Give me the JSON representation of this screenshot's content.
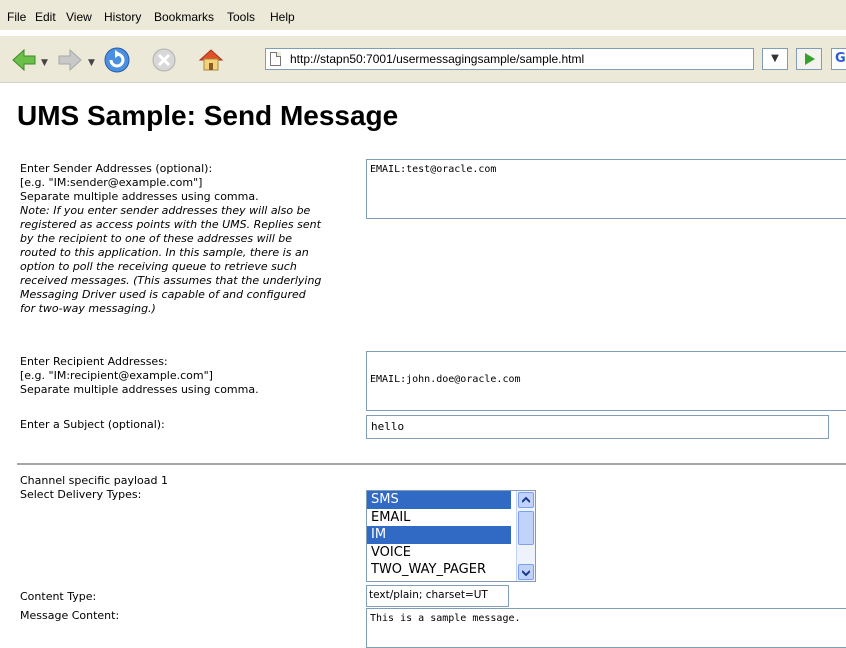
{
  "menu": {
    "items": [
      {
        "label": "File"
      },
      {
        "label": "Edit"
      },
      {
        "label": "View"
      },
      {
        "label": "History"
      },
      {
        "label": "Bookmarks"
      },
      {
        "label": "Tools"
      },
      {
        "label": "Help"
      }
    ]
  },
  "toolbar": {
    "url": "http://stapn50:7001/usermessagingsample/sample.html",
    "icons": [
      "back-arrow-icon",
      "forward-arrow-icon",
      "reload-icon",
      "stop-icon",
      "home-icon",
      "page-icon",
      "go-icon",
      "search-icon"
    ]
  },
  "page": {
    "title": "UMS Sample: Send Message"
  },
  "sender": {
    "label_line1": "Enter Sender Addresses (optional):",
    "label_line2": "[e.g. \"IM:sender@example.com\"]",
    "label_line3": "Separate multiple addresses using comma.",
    "note_lines": [
      "Note: If you enter sender addresses they will also be",
      "registered as access points with the UMS. Replies sent",
      "by the recipient to one of these addresses will be",
      "routed to this application. In this sample, there is an",
      "option to poll the receiving queue to retrieve such",
      "received messages. (This assumes that the underlying",
      "Messaging Driver used is capable of and configured",
      "for two-way messaging.)"
    ],
    "value": "EMAIL:test@oracle.com"
  },
  "recipient": {
    "label_line1": "Enter Recipient Addresses:",
    "label_line2": "[e.g. \"IM:recipient@example.com\"]",
    "label_line3": "Separate multiple addresses using comma.",
    "value": "EMAIL:john.doe@oracle.com"
  },
  "subject": {
    "label": "Enter a Subject (optional):",
    "value": "hello"
  },
  "payload": {
    "heading": "Channel specific payload 1",
    "delivery_label": "Select Delivery Types:",
    "delivery_options": [
      {
        "label": "SMS",
        "selected": true
      },
      {
        "label": "EMAIL",
        "selected": false
      },
      {
        "label": "IM",
        "selected": true
      },
      {
        "label": "VOICE",
        "selected": false
      },
      {
        "label": "TWO_WAY_PAGER",
        "selected": false
      }
    ],
    "content_type_label": "Content Type:",
    "content_type_value": "text/plain; charset=UT",
    "message_label": "Message Content:",
    "message_value": "This is a sample message."
  },
  "colors": {
    "selection": "#316ac5",
    "chrome": "#ece9d8",
    "input_border": "#7f9db9"
  }
}
